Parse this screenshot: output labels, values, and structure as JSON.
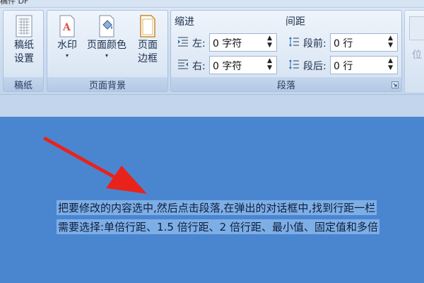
{
  "title_bar": {
    "text": "稿件 DF"
  },
  "groups": {
    "gaozhi": {
      "label": "稿纸",
      "button": {
        "label_line1": "稿纸",
        "label_line2": "设置",
        "icon": "manuscript-grid-icon"
      }
    },
    "page_background": {
      "label": "页面背景",
      "watermark": {
        "label": "水印",
        "icon": "watermark-icon"
      },
      "page_color": {
        "label": "页面颜色",
        "icon": "paint-bucket-icon"
      },
      "page_border": {
        "label_line1": "页面",
        "label_line2": "边框",
        "icon": "page-border-icon"
      }
    },
    "paragraph": {
      "label": "段落",
      "indent": {
        "title": "缩进",
        "left_label": "左:",
        "left_value": "0 字符",
        "right_label": "右:",
        "right_value": "0 字符"
      },
      "spacing": {
        "title": "间距",
        "before_label": "段前:",
        "before_value": "0 行",
        "after_label": "段后:",
        "after_value": "0 行"
      }
    },
    "arrange": {
      "label": "位"
    }
  },
  "document": {
    "line1": "把要修改的内容选中,然后点击段落,在弹出的对话框中,找到行距一栏",
    "line2": "需要选择:单倍行距、1.5 倍行距、2 倍行距、最小值、固定值和多倍"
  },
  "colors": {
    "annotation_arrow": "#e8231c",
    "document_background": "#4a86d0",
    "selection_highlight": "#7eaee6"
  }
}
